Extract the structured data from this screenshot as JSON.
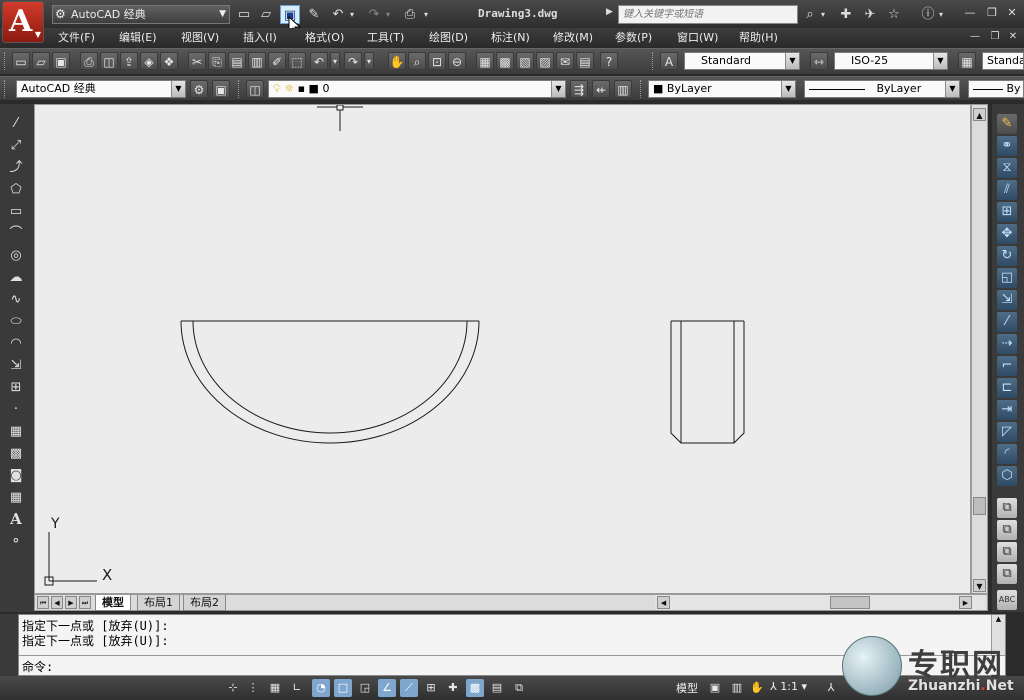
{
  "window": {
    "workspace": "AutoCAD 经典",
    "doc_title": "Drawing3.dwg",
    "search_placeholder": "键入关键字或短语"
  },
  "menu": {
    "items": [
      "文件(F)",
      "编辑(E)",
      "视图(V)",
      "插入(I)",
      "格式(O)",
      "工具(T)",
      "绘图(D)",
      "标注(N)",
      "修改(M)",
      "参数(P)",
      "窗口(W)",
      "帮助(H)"
    ]
  },
  "toolbar_styles": {
    "text_style": "Standard",
    "dim_style": "ISO-25",
    "table_style": "Standa"
  },
  "toolbar_layers": {
    "workspace": "AutoCAD 经典",
    "layer": "0",
    "color": "ByLayer",
    "linetype": "ByLayer",
    "lineweight": "By"
  },
  "drawing": {
    "ucs_y": "Y",
    "ucs_x": "X",
    "stroke_color": "#1a1a1a",
    "background_color": "#ececec"
  },
  "tabs": {
    "items": [
      "模型",
      "布局1",
      "布局2"
    ],
    "active": "模型"
  },
  "command": {
    "history": [
      "指定下一点或 [放弃(U)]:",
      "指定下一点或 [放弃(U)]:"
    ],
    "prompt": "命令:"
  },
  "status": {
    "model_label": "模型",
    "scale": "1:1"
  },
  "watermark": {
    "cn": "专职网",
    "en_pre": "Zhuanzhi",
    "en_dot": ".",
    "en_post": "Net"
  },
  "icons": {
    "app": "autocad-a-icon",
    "save": "save-icon",
    "cursor": "mouse-cursor-icon"
  }
}
